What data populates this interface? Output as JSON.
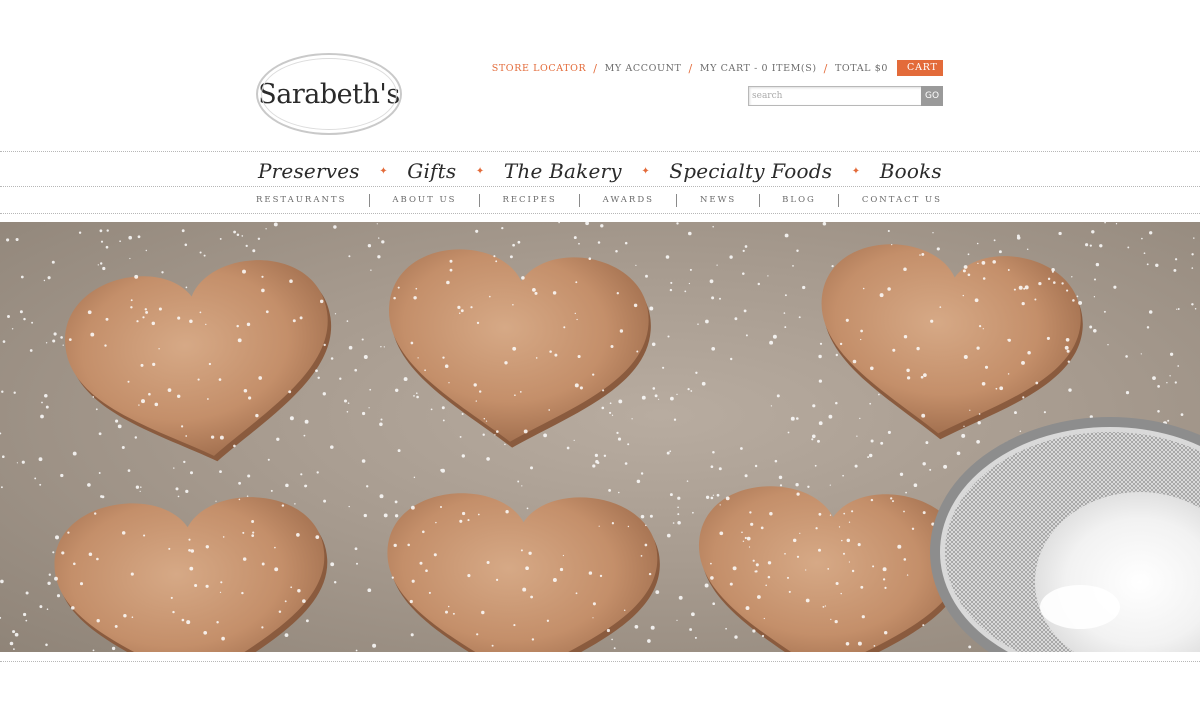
{
  "brand": {
    "logo_text": "Sarabeth's"
  },
  "utility_nav": {
    "store_locator": "STORE LOCATOR",
    "my_account": "MY ACCOUNT",
    "my_cart": "MY CART - 0 ITEM(S)",
    "total": "TOTAL $0",
    "separator": "/",
    "cart_button": "CART"
  },
  "search": {
    "placeholder": "search",
    "button": "GO"
  },
  "primary_nav": {
    "items": [
      "Preserves",
      "Gifts",
      "The Bakery",
      "Specialty Foods",
      "Books"
    ],
    "divider": "✦"
  },
  "secondary_nav": {
    "items": [
      "RESTAURANTS",
      "ABOUT US",
      "RECIPES",
      "AWARDS",
      "NEWS",
      "BLOG",
      "CONTACT US"
    ]
  },
  "hero": {
    "subject": "heart-cookies-powdered-sugar-sieve"
  },
  "colors": {
    "accent": "#e36b3a",
    "text": "#444444",
    "divider": "#b7b7b7"
  }
}
